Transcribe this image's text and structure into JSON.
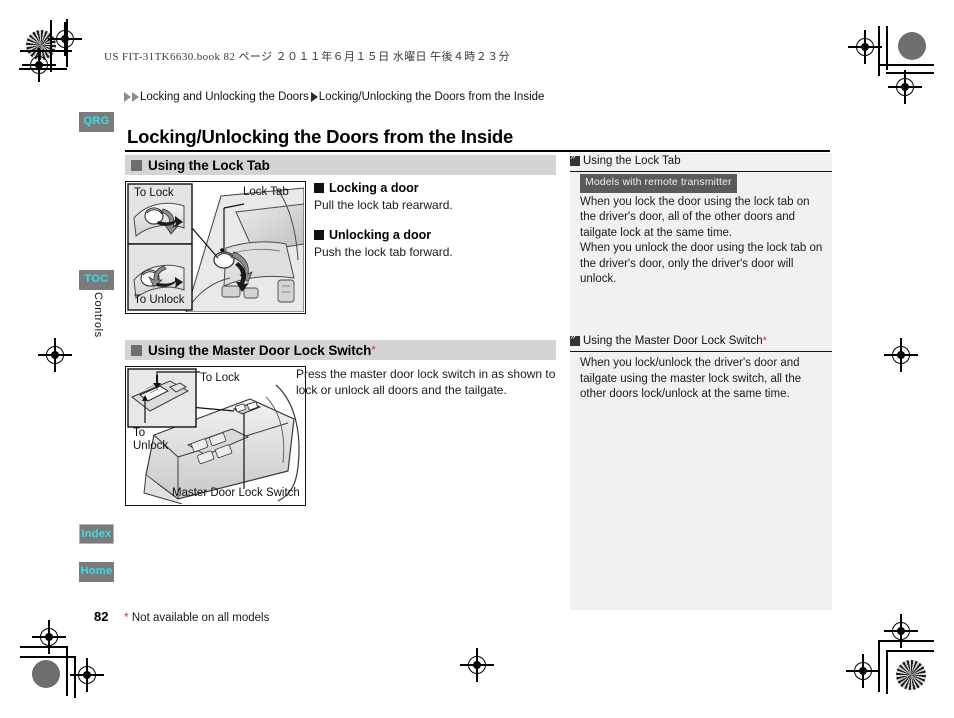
{
  "book_header": "US FIT-31TK6630.book   82 ページ   ２０１１年６月１５日   水曜日   午後４時２３分",
  "breadcrumb": {
    "parent": "Locking and Unlocking the Doors",
    "current": "Locking/Unlocking the Doors from the Inside"
  },
  "page_title": "Locking/Unlocking the Doors from the Inside",
  "nav": {
    "qrg": "QRG",
    "toc": "TOC",
    "chapter": "Controls",
    "index": "Index",
    "home": "Home"
  },
  "sections": [
    {
      "heading": "Using the Lock Tab",
      "has_asterisk": false,
      "illustration": {
        "labels": {
          "to_lock": "To Lock",
          "to_unlock": "To Unlock",
          "callout": "Lock Tab"
        }
      },
      "blocks": [
        {
          "subhead": "Locking a door",
          "text": "Pull the lock tab rearward."
        },
        {
          "subhead": "Unlocking a door",
          "text": "Push the lock tab forward."
        }
      ]
    },
    {
      "heading": "Using the Master Door Lock Switch",
      "has_asterisk": true,
      "illustration": {
        "labels": {
          "to_lock": "To Lock",
          "to_unlock_line1": "To",
          "to_unlock_line2": "Unlock",
          "callout": "Master Door Lock Switch"
        }
      },
      "paragraph": "Press the master door lock switch in as shown to lock or unlock all doors and the tailgate."
    }
  ],
  "side_panel": {
    "notes": [
      {
        "title": "Using the Lock Tab",
        "has_asterisk": false,
        "badge": "Models with remote transmitter",
        "body": "When you lock the door using the lock tab on the driver's door, all of the other doors and tailgate lock at the same time.\nWhen you unlock the door using the lock tab on the driver's door, only the driver's door will unlock."
      },
      {
        "title": "Using the Master Door Lock Switch",
        "has_asterisk": true,
        "badge": "",
        "body": "When you lock/unlock the driver's door and tailgate using the master lock switch, all the other doors lock/unlock at the same time."
      }
    ]
  },
  "footer": {
    "page_number": "82",
    "footnote_marker": "*",
    "footnote": "Not available on all models"
  },
  "colors": {
    "tab_bg": "#7b7b7b",
    "tab_text": "#31e0e8",
    "section_bar": "#d4d4d4",
    "panel_bg": "#f1f1f1",
    "asterisk_red": "#e8322a",
    "badge_bg": "#5a5a5a"
  }
}
